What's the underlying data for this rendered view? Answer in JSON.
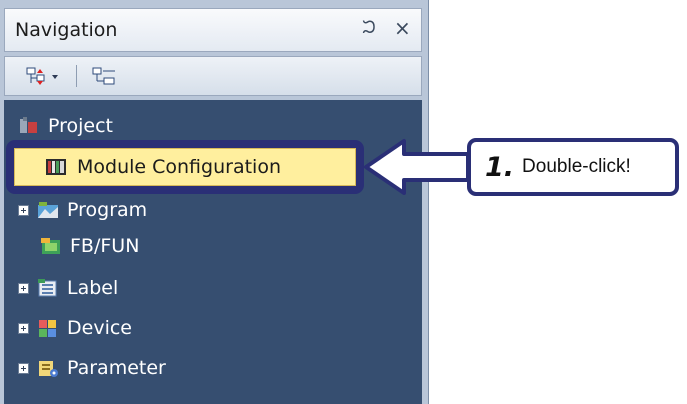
{
  "window": {
    "title": "Navigation",
    "pin_glyph": "ᙂ",
    "close_glyph": "×"
  },
  "toolbar": {
    "items": [
      {
        "name": "expand-collapse-tree-icon"
      },
      {
        "name": "tree-view-icon"
      }
    ]
  },
  "tree": {
    "items": [
      {
        "label": "Project",
        "icon": "project-icon",
        "expandable": false
      },
      {
        "label": "Module Configuration",
        "icon": "module-configuration-icon",
        "expandable": false,
        "selected": true
      },
      {
        "label": "Program",
        "icon": "program-icon",
        "expandable": true
      },
      {
        "label": "FB/FUN",
        "icon": "fb-fun-icon",
        "expandable": false
      },
      {
        "label": "Label",
        "icon": "label-icon",
        "expandable": true
      },
      {
        "label": "Device",
        "icon": "device-icon",
        "expandable": true
      },
      {
        "label": "Parameter",
        "icon": "parameter-icon",
        "expandable": true
      }
    ]
  },
  "callout": {
    "step": "1.",
    "text": "Double-click!"
  },
  "colors": {
    "tree_background": "#364e70",
    "highlight_fill": "#ffef9e",
    "callout_border": "#2a2f76"
  }
}
